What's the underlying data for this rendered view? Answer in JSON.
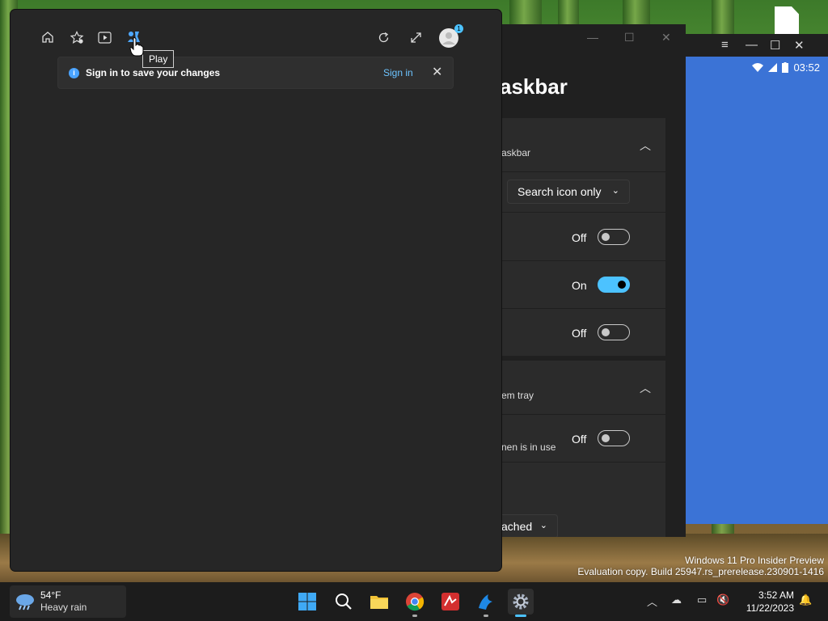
{
  "desktop": {
    "watermark_line1": "Windows 11 Pro Insider Preview",
    "watermark_line2": "Evaluation copy. Build 25947.rs_prerelease.230901-1416"
  },
  "android": {
    "time": "03:52",
    "menu_icon": "≡",
    "min_icon": "—",
    "max_icon": "☐",
    "close_icon": "✕"
  },
  "settings": {
    "heading": "askbar",
    "section1_title": "askbar",
    "search_dropdown": "Search icon only",
    "toggle1_label": "Off",
    "toggle2_label": "On",
    "toggle3_label": "Off",
    "section2_title": "em tray",
    "row_text": "nen is in use",
    "toggle4_label": "Off",
    "bottom_dropdown": "ached"
  },
  "panel": {
    "tooltip": "Play",
    "banner_message": "Sign in to save your changes",
    "banner_link": "Sign in",
    "avatar_badge": "1"
  },
  "taskbar": {
    "weather_temp": "54°F",
    "weather_condition": "Heavy rain",
    "clock_time": "3:52 AM",
    "clock_date": "11/22/2023"
  },
  "colors": {
    "accent": "#4cc2ff",
    "link": "#6dc4ff",
    "panel_bg": "#262626"
  }
}
